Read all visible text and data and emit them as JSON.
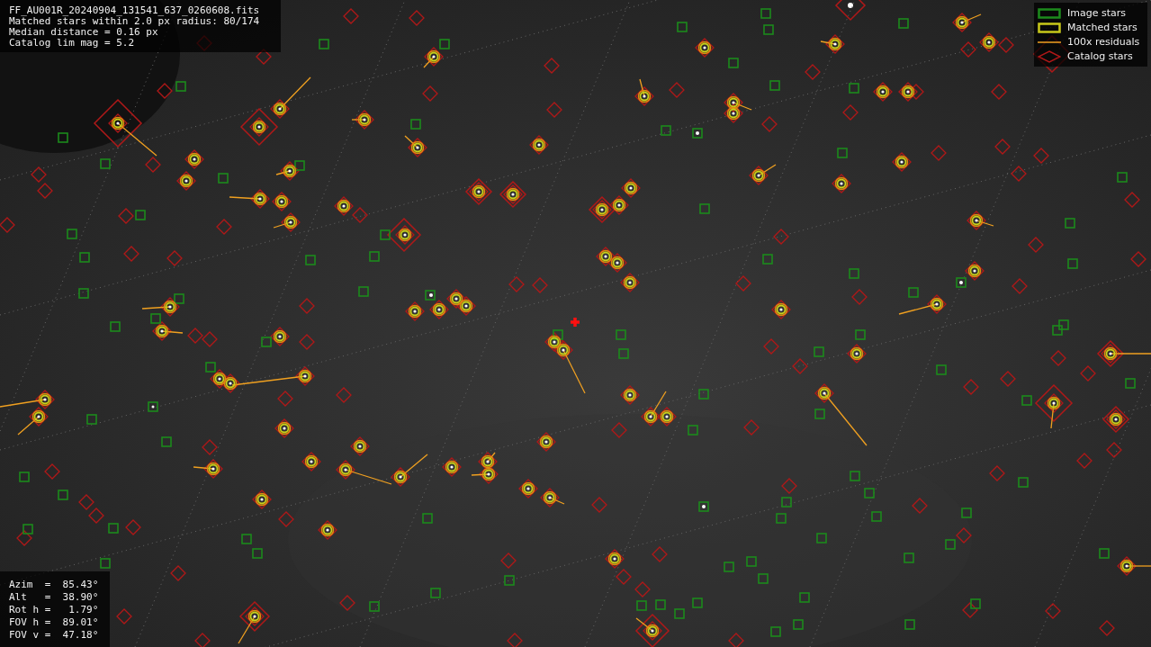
{
  "info_box": {
    "lines": [
      "FF_AU001R_20240904_131541_637_0260608.fits",
      "Matched stars within 2.0 px radius: 80/174",
      "Median distance = 0.16 px",
      "Catalog lim mag = 5.2"
    ]
  },
  "legend": [
    {
      "label": "Image stars"
    },
    {
      "kind": "matched",
      "label": "Matched stars"
    },
    {
      "kind": "residual",
      "label": "100x residuals"
    },
    {
      "kind": "catalog",
      "label": "Catalog stars"
    }
  ],
  "pointing": {
    "lines": [
      "Azim  =  85.43°",
      "Alt   =  38.90°",
      "Rot h =   1.79°",
      "FOV h =  89.01°",
      "FOV v =  47.18°"
    ]
  }
}
